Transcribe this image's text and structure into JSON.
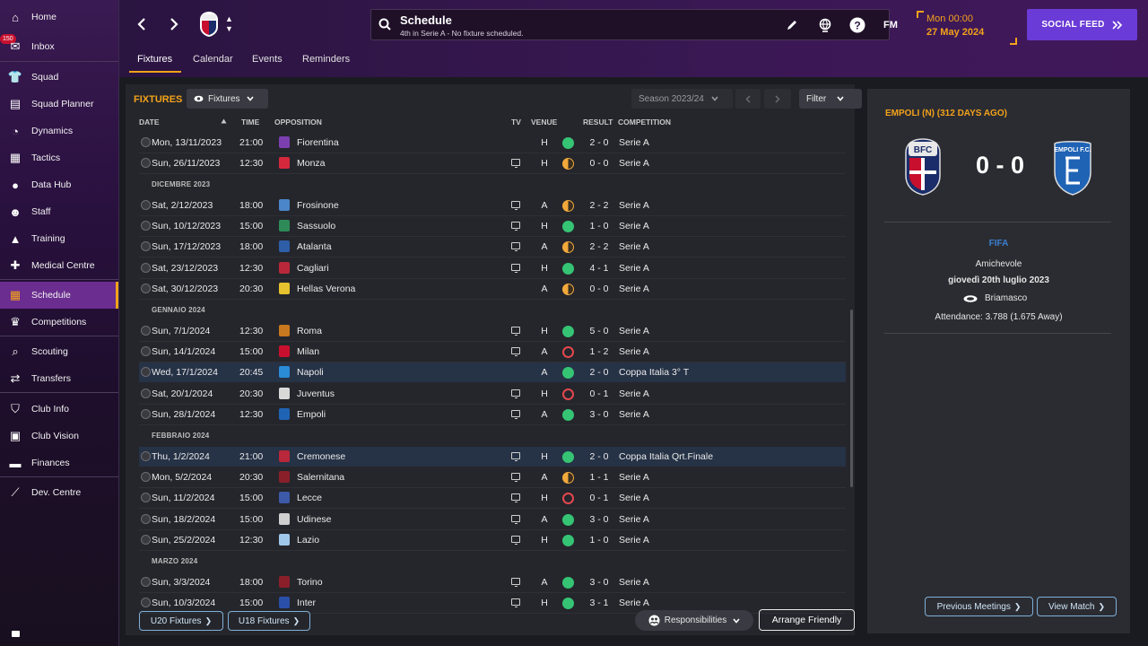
{
  "sidebar": {
    "inbox_badge": "150",
    "items": [
      {
        "label": "Home",
        "icon": "home-icon"
      },
      {
        "label": "Inbox",
        "icon": "inbox-icon"
      },
      {
        "label": "Squad",
        "icon": "shirt-icon"
      },
      {
        "label": "Squad Planner",
        "icon": "clipboard-icon"
      },
      {
        "label": "Dynamics",
        "icon": "dynamics-icon"
      },
      {
        "label": "Tactics",
        "icon": "tactics-board-icon"
      },
      {
        "label": "Data Hub",
        "icon": "data-hub-icon"
      },
      {
        "label": "Staff",
        "icon": "staff-icon"
      },
      {
        "label": "Training",
        "icon": "training-cone-icon"
      },
      {
        "label": "Medical Centre",
        "icon": "medical-icon"
      },
      {
        "label": "Schedule",
        "icon": "calendar-icon"
      },
      {
        "label": "Competitions",
        "icon": "trophy-icon"
      },
      {
        "label": "Scouting",
        "icon": "magnifier-icon"
      },
      {
        "label": "Transfers",
        "icon": "transfers-icon"
      },
      {
        "label": "Club Info",
        "icon": "shield-icon"
      },
      {
        "label": "Club Vision",
        "icon": "briefcase-icon"
      },
      {
        "label": "Finances",
        "icon": "money-icon"
      },
      {
        "label": "Dev. Centre",
        "icon": "dev-centre-icon"
      }
    ]
  },
  "header": {
    "title": "Schedule",
    "subtitle": "4th in Serie A - No fixture scheduled.",
    "fm_label": "FM",
    "date_time": "Mon 00:00",
    "date": "27 May 2024",
    "social_feed": "SOCIAL FEED",
    "tabs": [
      "Fixtures",
      "Calendar",
      "Events",
      "Reminders"
    ]
  },
  "fixtures": {
    "heading": "FIXTURES",
    "view_dropdown": "Fixtures",
    "season": "Season 2023/24",
    "filter": "Filter",
    "columns": {
      "date": "DATE",
      "time": "TIME",
      "opposition": "OPPOSITION",
      "tv": "TV",
      "venue": "VENUE",
      "result": "RESULT",
      "competition": "COMPETITION"
    },
    "months": [
      "DICEMBRE 2023",
      "GENNAIO 2024",
      "FEBBRAIO 2024",
      "MARZO 2024"
    ],
    "rows": [
      {
        "date": "Mon, 13/11/2023",
        "time": "21:00",
        "opp": "Fiorentina",
        "tv": false,
        "venue": "H",
        "res": "W",
        "score": "2 - 0",
        "comp": "Serie A",
        "crest": "#7b3fb0"
      },
      {
        "date": "Sun, 26/11/2023",
        "time": "12:30",
        "opp": "Monza",
        "tv": true,
        "venue": "H",
        "res": "D",
        "score": "0 - 0",
        "comp": "Serie A",
        "crest": "#d6283c"
      },
      {
        "date": "Sat, 2/12/2023",
        "time": "18:00",
        "opp": "Frosinone",
        "tv": true,
        "venue": "A",
        "res": "D",
        "score": "2 - 2",
        "comp": "Serie A",
        "crest": "#4a86c8"
      },
      {
        "date": "Sun, 10/12/2023",
        "time": "15:00",
        "opp": "Sassuolo",
        "tv": true,
        "venue": "H",
        "res": "W",
        "score": "1 - 0",
        "comp": "Serie A",
        "crest": "#2e8b57"
      },
      {
        "date": "Sun, 17/12/2023",
        "time": "18:00",
        "opp": "Atalanta",
        "tv": true,
        "venue": "A",
        "res": "D",
        "score": "2 - 2",
        "comp": "Serie A",
        "crest": "#2f5ea8"
      },
      {
        "date": "Sat, 23/12/2023",
        "time": "12:30",
        "opp": "Cagliari",
        "tv": true,
        "venue": "H",
        "res": "W",
        "score": "4 - 1",
        "comp": "Serie A",
        "crest": "#b8283a"
      },
      {
        "date": "Sat, 30/12/2023",
        "time": "20:30",
        "opp": "Hellas Verona",
        "tv": false,
        "venue": "A",
        "res": "D",
        "score": "0 - 0",
        "comp": "Serie A",
        "crest": "#e5c22e"
      },
      {
        "date": "Sun, 7/1/2024",
        "time": "12:30",
        "opp": "Roma",
        "tv": true,
        "venue": "H",
        "res": "W",
        "score": "5 - 0",
        "comp": "Serie A",
        "crest": "#c8781e"
      },
      {
        "date": "Sun, 14/1/2024",
        "time": "15:00",
        "opp": "Milan",
        "tv": true,
        "venue": "A",
        "res": "L",
        "score": "1 - 2",
        "comp": "Serie A",
        "crest": "#c8102e"
      },
      {
        "date": "Wed, 17/1/2024",
        "time": "20:45",
        "opp": "Napoli",
        "tv": false,
        "venue": "A",
        "res": "W",
        "score": "2 - 0",
        "comp": "Coppa Italia 3° T",
        "crest": "#2a8bd6",
        "hl": true
      },
      {
        "date": "Sat, 20/1/2024",
        "time": "20:30",
        "opp": "Juventus",
        "tv": true,
        "venue": "H",
        "res": "L",
        "score": "0 - 1",
        "comp": "Serie A",
        "crest": "#d8d8d8"
      },
      {
        "date": "Sun, 28/1/2024",
        "time": "12:30",
        "opp": "Empoli",
        "tv": true,
        "venue": "A",
        "res": "W",
        "score": "3 - 0",
        "comp": "Serie A",
        "crest": "#1f63b5"
      },
      {
        "date": "Thu, 1/2/2024",
        "time": "21:00",
        "opp": "Cremonese",
        "tv": true,
        "venue": "H",
        "res": "W",
        "score": "2 - 0",
        "comp": "Coppa Italia Qrt.Finale",
        "crest": "#b8283a",
        "hl": true
      },
      {
        "date": "Mon, 5/2/2024",
        "time": "20:30",
        "opp": "Salernitana",
        "tv": true,
        "venue": "A",
        "res": "D",
        "score": "1 - 1",
        "comp": "Serie A",
        "crest": "#8a1f2a"
      },
      {
        "date": "Sun, 11/2/2024",
        "time": "15:00",
        "opp": "Lecce",
        "tv": true,
        "venue": "H",
        "res": "L",
        "score": "0 - 1",
        "comp": "Serie A",
        "crest": "#3c5aa8"
      },
      {
        "date": "Sun, 18/2/2024",
        "time": "15:00",
        "opp": "Udinese",
        "tv": true,
        "venue": "A",
        "res": "W",
        "score": "3 - 0",
        "comp": "Serie A",
        "crest": "#cfcfcf"
      },
      {
        "date": "Sun, 25/2/2024",
        "time": "12:30",
        "opp": "Lazio",
        "tv": true,
        "venue": "H",
        "res": "W",
        "score": "1 - 0",
        "comp": "Serie A",
        "crest": "#9fc7ea"
      },
      {
        "date": "Sun, 3/3/2024",
        "time": "18:00",
        "opp": "Torino",
        "tv": true,
        "venue": "A",
        "res": "W",
        "score": "3 - 0",
        "comp": "Serie A",
        "crest": "#8a1f2a"
      },
      {
        "date": "Sun, 10/3/2024",
        "time": "15:00",
        "opp": "Inter",
        "tv": true,
        "venue": "H",
        "res": "W",
        "score": "3 - 1",
        "comp": "Serie A",
        "crest": "#2a4fa8"
      }
    ],
    "u20": "U20 Fixtures",
    "u18": "U18 Fixtures",
    "responsibilities": "Responsibilities",
    "arrange_friendly": "Arrange Friendly"
  },
  "match_panel": {
    "title": "EMPOLI (N) (312 DAYS AGO)",
    "score": "0 - 0",
    "organizer": "FIFA",
    "competition": "Amichevole",
    "date": "giovedì 20th luglio 2023",
    "stadium": "Briamasco",
    "attendance": "Attendance: 3.788 (1.675 Away)",
    "previous_meetings": "Previous Meetings",
    "view_match": "View Match",
    "home_crest_text": "BFC",
    "away_crest_text": "EMPOLI F.C."
  },
  "colors": {
    "accent": "#f3a21a",
    "sidebar_active": "#6b2d8f",
    "win": "#35c474",
    "loss": "#e5484d",
    "draw": "#f2a93b",
    "social": "#6a3bd6"
  }
}
